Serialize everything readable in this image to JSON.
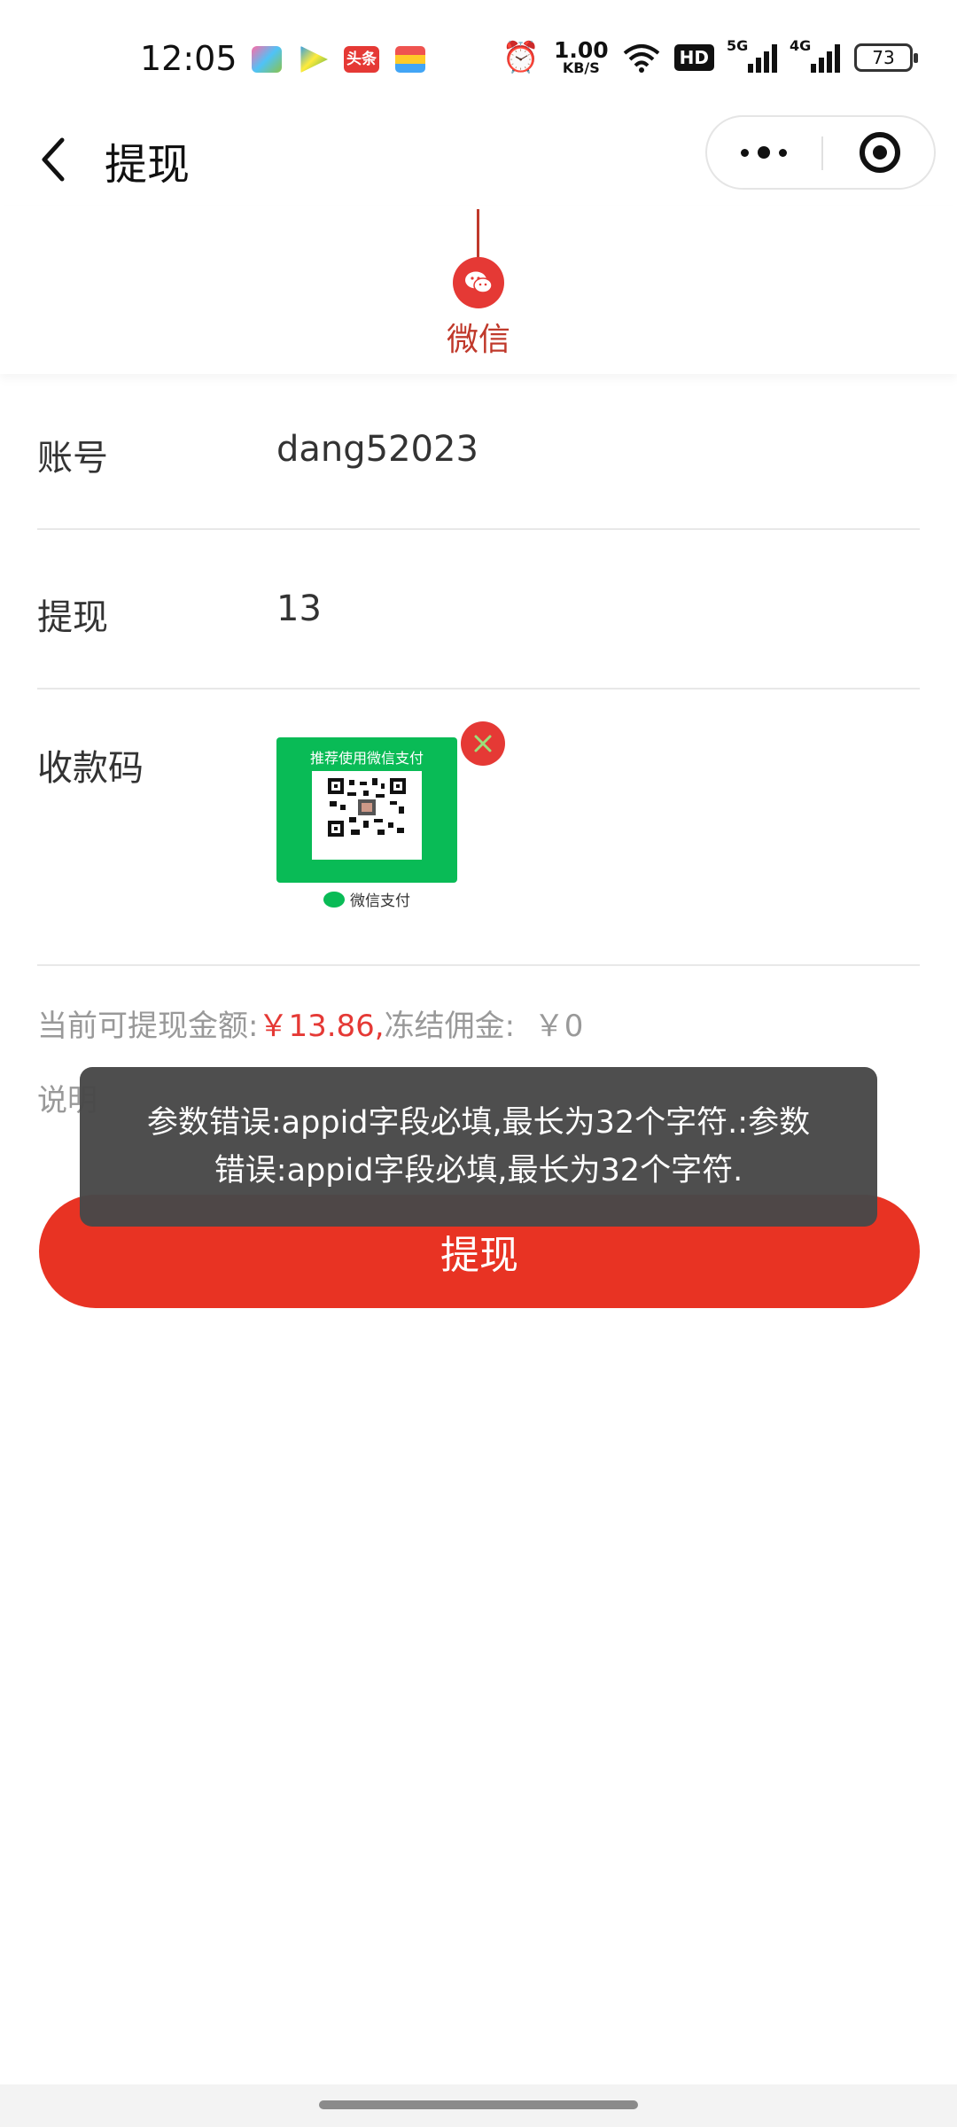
{
  "status_bar": {
    "time": "12:05",
    "app_badge_text": "头条",
    "net_speed_value": "1.00",
    "net_speed_unit": "KB/S",
    "hd_label": "HD",
    "sig1_label": "5G",
    "sig2_label": "4G",
    "battery": "73"
  },
  "nav": {
    "title": "提现"
  },
  "method": {
    "label": "微信",
    "icon": "wechat-icon"
  },
  "form": {
    "account_label": "账号",
    "account_value": "dang52023",
    "amount_label": "提现",
    "amount_value": "13",
    "qrcode_label": "收款码",
    "qr_header": "推荐使用微信支付",
    "qr_foot": "微信支付"
  },
  "balance": {
    "prefix": "当前可提现金额:",
    "available": "￥13.86,",
    "frozen_label": "冻结佣金:",
    "frozen_value": "￥0"
  },
  "explain": {
    "text": "说明"
  },
  "submit": {
    "label": "提现"
  },
  "toast": {
    "message": "参数错误:appid字段必填,最长为32个字符.:参数错误:appid字段必填,最长为32个字符."
  },
  "colors": {
    "accent": "#e83323",
    "wechat_green": "#09bb56",
    "toast_bg": "#484848"
  }
}
